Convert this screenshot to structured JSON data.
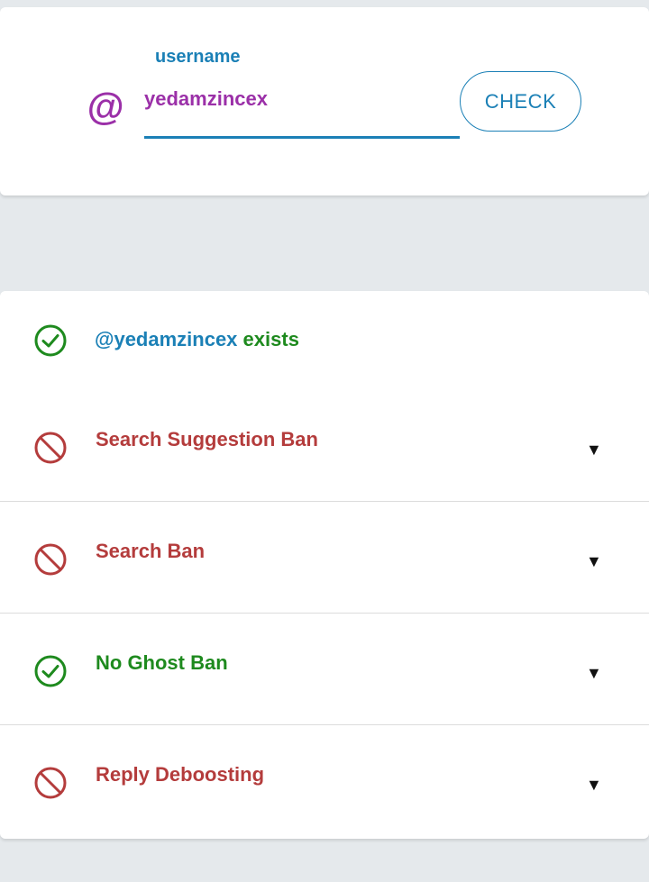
{
  "form": {
    "label": "username",
    "at_symbol": "@",
    "username_value": "yedamzincex",
    "check_label": "CHECK"
  },
  "exists": {
    "handle": "@yedamzincex",
    "word": "exists",
    "icon": "check-circle-icon"
  },
  "results": [
    {
      "label": "Search Suggestion Ban",
      "status": "ban",
      "icon": "prohibited-icon",
      "toggle": "▼"
    },
    {
      "label": "Search Ban",
      "status": "ban",
      "icon": "prohibited-icon",
      "toggle": "▼"
    },
    {
      "label": "No Ghost Ban",
      "status": "ok",
      "icon": "check-circle-icon",
      "toggle": "▼"
    },
    {
      "label": "Reply Deboosting",
      "status": "ban",
      "icon": "prohibited-icon",
      "toggle": "▼"
    }
  ],
  "colors": {
    "accent": "#1b80b6",
    "handle": "#9b30a8",
    "ok": "#1e8a1e",
    "ban": "#b43c3c"
  }
}
